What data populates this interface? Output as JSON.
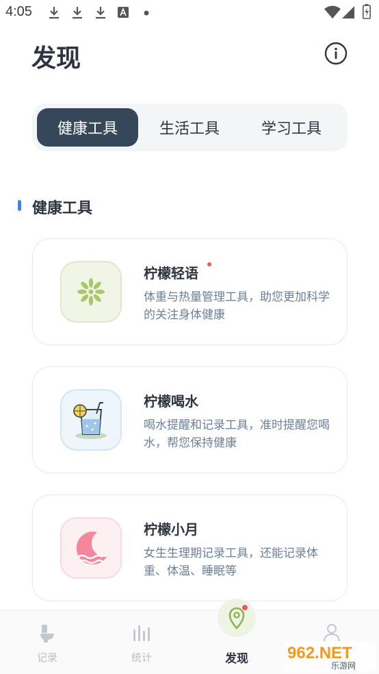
{
  "status_bar": {
    "time": "4:05",
    "icons": [
      "download-icon",
      "download-icon",
      "download-icon",
      "font-app-icon",
      "dot-icon",
      "wifi-icon",
      "signal-icon",
      "battery-charging-icon"
    ]
  },
  "header": {
    "title": "发现",
    "info_icon": "info-icon"
  },
  "tabs": [
    {
      "label": "健康工具",
      "active": true
    },
    {
      "label": "生活工具",
      "active": false
    },
    {
      "label": "学习工具",
      "active": false
    }
  ],
  "section": {
    "title": "健康工具",
    "marker_color": "#3d86e0"
  },
  "cards": [
    {
      "title": "柠檬轻语",
      "desc": "体重与热量管理工具，助您更加科学的关注身体健康",
      "icon": "lemon-slice-icon",
      "has_dot": true
    },
    {
      "title": "柠檬喝水",
      "desc": "喝水提醒和记录工具，准时提醒您喝水，帮您保持健康",
      "icon": "water-glass-icon",
      "has_dot": false
    },
    {
      "title": "柠檬小月",
      "desc": "女生生理期记录工具，还能记录体重、体温、睡眠等",
      "icon": "crescent-moon-icon",
      "has_dot": false
    }
  ],
  "bottom_nav": [
    {
      "label": "记录",
      "icon": "toilet-icon",
      "active": false
    },
    {
      "label": "统计",
      "icon": "bar-stats-icon",
      "active": false
    },
    {
      "label": "发现",
      "icon": "location-pin-icon",
      "active": true
    },
    {
      "label": "",
      "icon": "profile-icon",
      "active": false
    }
  ],
  "watermark": {
    "brand": "962.NET",
    "sub": "乐游网"
  },
  "colors": {
    "tab_active": "#37475a",
    "accent_dot": "#f0565a",
    "desc_text": "#6b7f99"
  }
}
